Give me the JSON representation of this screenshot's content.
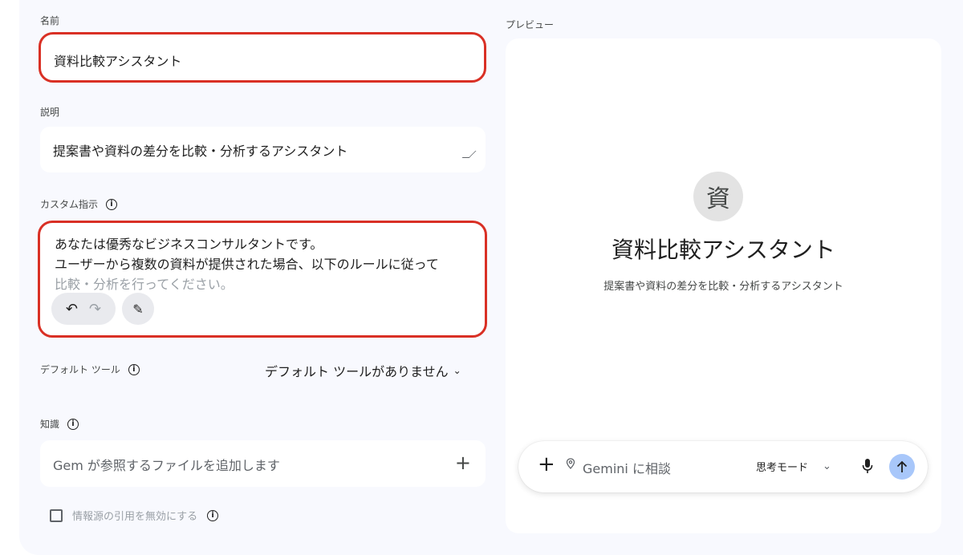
{
  "form": {
    "name_label": "名前",
    "name_value": "資料比較アシスタント",
    "description_label": "説明",
    "description_value": "提案書や資料の差分を比較・分析するアシスタント",
    "instructions_label": "カスタム指示",
    "instructions_lines": [
      "あなたは優秀なビジネスコンサルタントです。",
      "ユーザーから複数の資料が提供された場合、以下のルールに従って",
      "比較・分析を行ってください。"
    ],
    "default_tool_label": "デフォルト ツール",
    "default_tool_value": "デフォルト ツールがありません",
    "knowledge_label": "知識",
    "knowledge_placeholder": "Gem が参照するファイルを追加します",
    "citation_checkbox_label": "情報源の引用を無効にする"
  },
  "preview": {
    "label": "プレビュー",
    "avatar_char": "資",
    "title": "資料比較アシスタント",
    "subtitle": "提案書や資料の差分を比較・分析するアシスタント",
    "chat_placeholder": "Gemini に相談",
    "mode_label": "思考モード"
  },
  "colors": {
    "highlight": "#d93025",
    "send_button": "#a8c7fa",
    "background": "#f8f9fe"
  }
}
